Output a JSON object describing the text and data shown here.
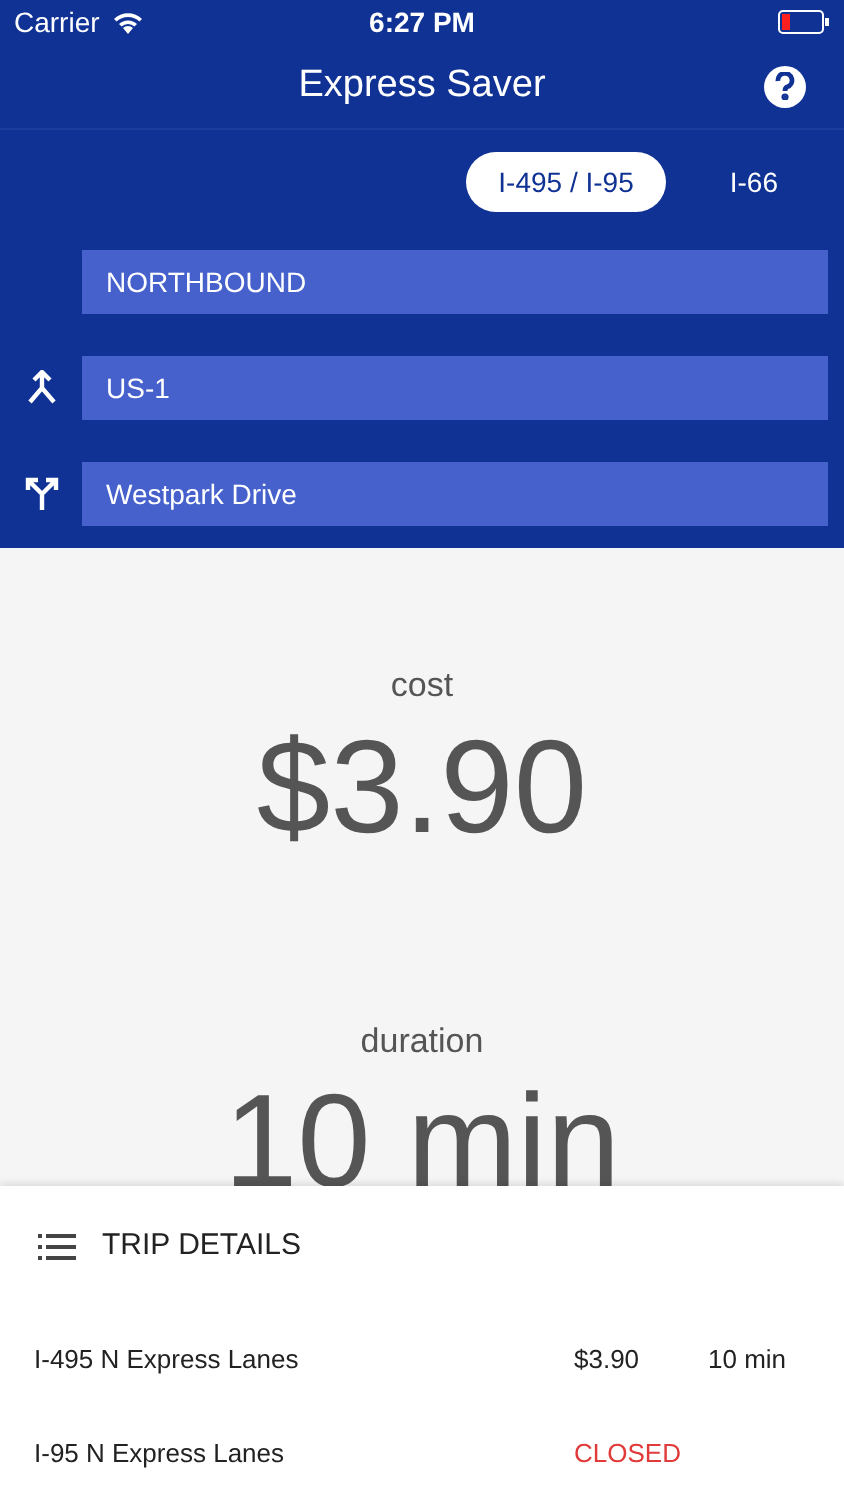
{
  "status_bar": {
    "carrier": "Carrier",
    "time": "6:27 PM"
  },
  "nav": {
    "title": "Express Saver"
  },
  "tabs": [
    {
      "label": "I-495 / I-95",
      "selected": true
    },
    {
      "label": "I-66",
      "selected": false
    }
  ],
  "fields": [
    {
      "kind": "direction",
      "value": "NORTHBOUND"
    },
    {
      "kind": "entry",
      "value": "US-1"
    },
    {
      "kind": "exit",
      "value": "Westpark Drive"
    }
  ],
  "summary": {
    "cost_label": "cost",
    "cost": "$3.90",
    "duration_label": "duration",
    "duration": "10 min"
  },
  "trip_details": {
    "title": "TRIP DETAILS",
    "rows": [
      {
        "kind": "open",
        "name": "I-495 N Express Lanes",
        "cost": "$3.90",
        "duration": "10 min"
      },
      {
        "kind": "closed",
        "name": "I-95 N Express Lanes",
        "status": "CLOSED"
      }
    ]
  }
}
